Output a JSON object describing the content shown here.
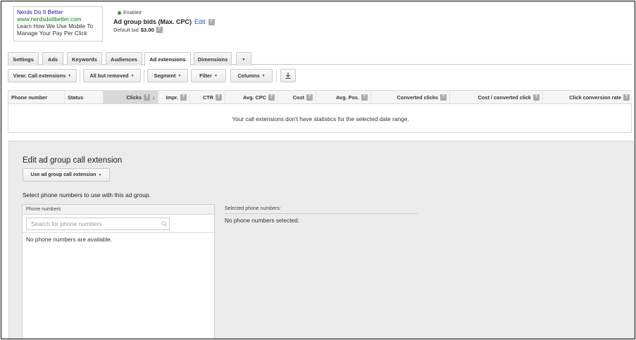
{
  "ad_preview": {
    "title": "Nerds Do It Better",
    "url": "www.nerdsdoitbetter.com",
    "line1": "Learn How We Use Mobile To",
    "line2": "Manage Your Pay Per Click"
  },
  "summary": {
    "status": "Enabled",
    "status_color": "#2a9d2a",
    "bids_label": "Ad group bids (Max. CPC)",
    "edit_label": "Edit",
    "default_bid_label": "Default bid",
    "default_bid_value": "$3.00"
  },
  "tabs": [
    {
      "label": "Settings"
    },
    {
      "label": "Ads"
    },
    {
      "label": "Keywords"
    },
    {
      "label": "Audiences"
    },
    {
      "label": "Ad extensions",
      "active": true
    },
    {
      "label": "Dimensions"
    },
    {
      "label": "▾"
    }
  ],
  "toolbar": {
    "view": "View: Call extensions",
    "filter_removed": "All but removed",
    "segment": "Segment",
    "filter": "Filter",
    "columns": "Columns",
    "download_icon": "download-icon"
  },
  "table": {
    "headers": [
      "Phone number",
      "Status",
      "Clicks",
      "Impr.",
      "CTR",
      "Avg. CPC",
      "Cost",
      "Avg. Pos.",
      "Converted clicks",
      "Cost / converted click",
      "Click conversion rate"
    ],
    "sorted_column": "Clicks",
    "empty_message": "Your call extensions don't have statistics for the selected date range."
  },
  "edit_panel": {
    "title": "Edit ad group call extension",
    "dropdown": "Use ad group call extension",
    "select_prompt": "Select phone numbers to use with this ad group.",
    "phone_numbers_header": "Phone numbers",
    "search_placeholder": "Search for phone numbers",
    "no_available": "No phone numbers are available.",
    "selected_header": "Selected phone numbers:",
    "none_selected": "No phone numbers selected."
  }
}
